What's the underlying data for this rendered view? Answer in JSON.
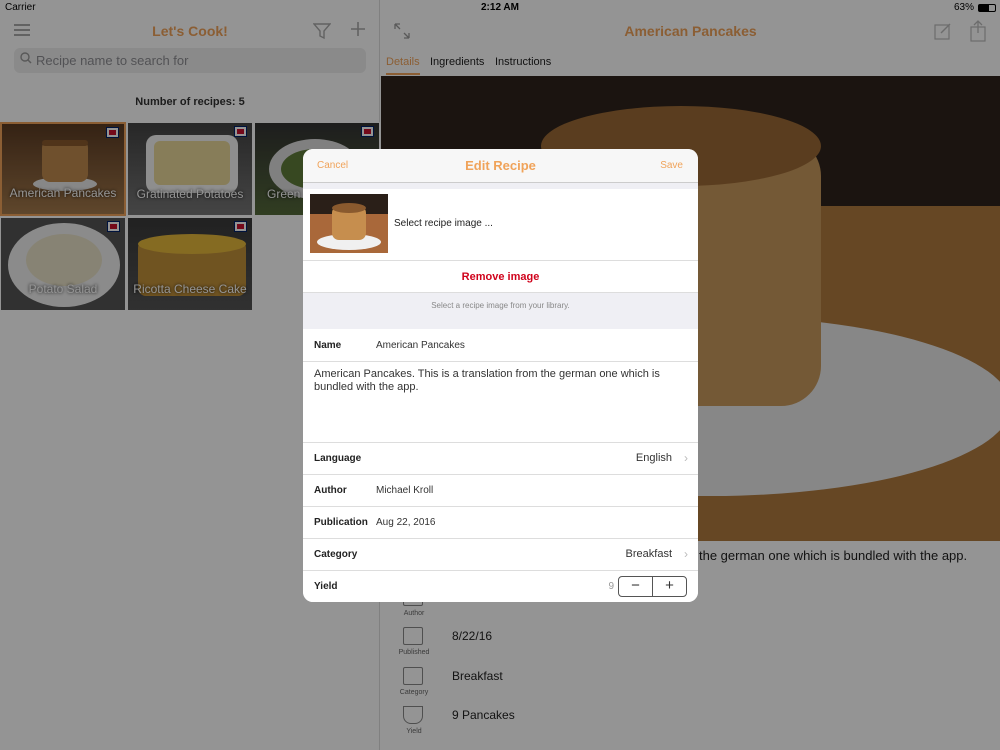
{
  "status": {
    "carrier": "Carrier",
    "time": "2:12 AM",
    "battery": "63%"
  },
  "left": {
    "title": "Let's Cook!",
    "search_placeholder": "Recipe name to search for",
    "count": "Number of recipes: 5",
    "recipes": [
      {
        "name": "American Pancakes"
      },
      {
        "name": "Gratinated Potatoes"
      },
      {
        "name": "Green"
      },
      {
        "name": "Potato Salad"
      },
      {
        "name": "Ricotta Cheese Cake"
      }
    ]
  },
  "right": {
    "title": "American Pancakes",
    "tabs": [
      "Details",
      "Ingredients",
      "Instructions"
    ],
    "description_tail": "the german one which is bundled with the app.",
    "meta": [
      {
        "caption": "Author",
        "value": ""
      },
      {
        "caption": "Published",
        "value": "8/22/16"
      },
      {
        "caption": "Category",
        "value": "Breakfast"
      },
      {
        "caption": "Yield",
        "value": "9 Pancakes"
      }
    ]
  },
  "modal": {
    "cancel": "Cancel",
    "title": "Edit Recipe",
    "save": "Save",
    "select_image": "Select recipe image ...",
    "remove_image": "Remove image",
    "hint": "Select a recipe image from your library.",
    "name_label": "Name",
    "name_value": "American Pancakes",
    "description": "American Pancakes. This is a translation from the german one which is bundled with the app.",
    "language_label": "Language",
    "language_value": "English",
    "author_label": "Author",
    "author_value": "Michael Kroll",
    "publication_label": "Publication",
    "publication_value": "Aug 22, 2016",
    "category_label": "Category",
    "category_value": "Breakfast",
    "yield_label": "Yield",
    "yield_value": "9",
    "minus": "−",
    "plus": "+"
  },
  "colors": {
    "accent": "#f0a35a",
    "remove": "#d0021b"
  }
}
